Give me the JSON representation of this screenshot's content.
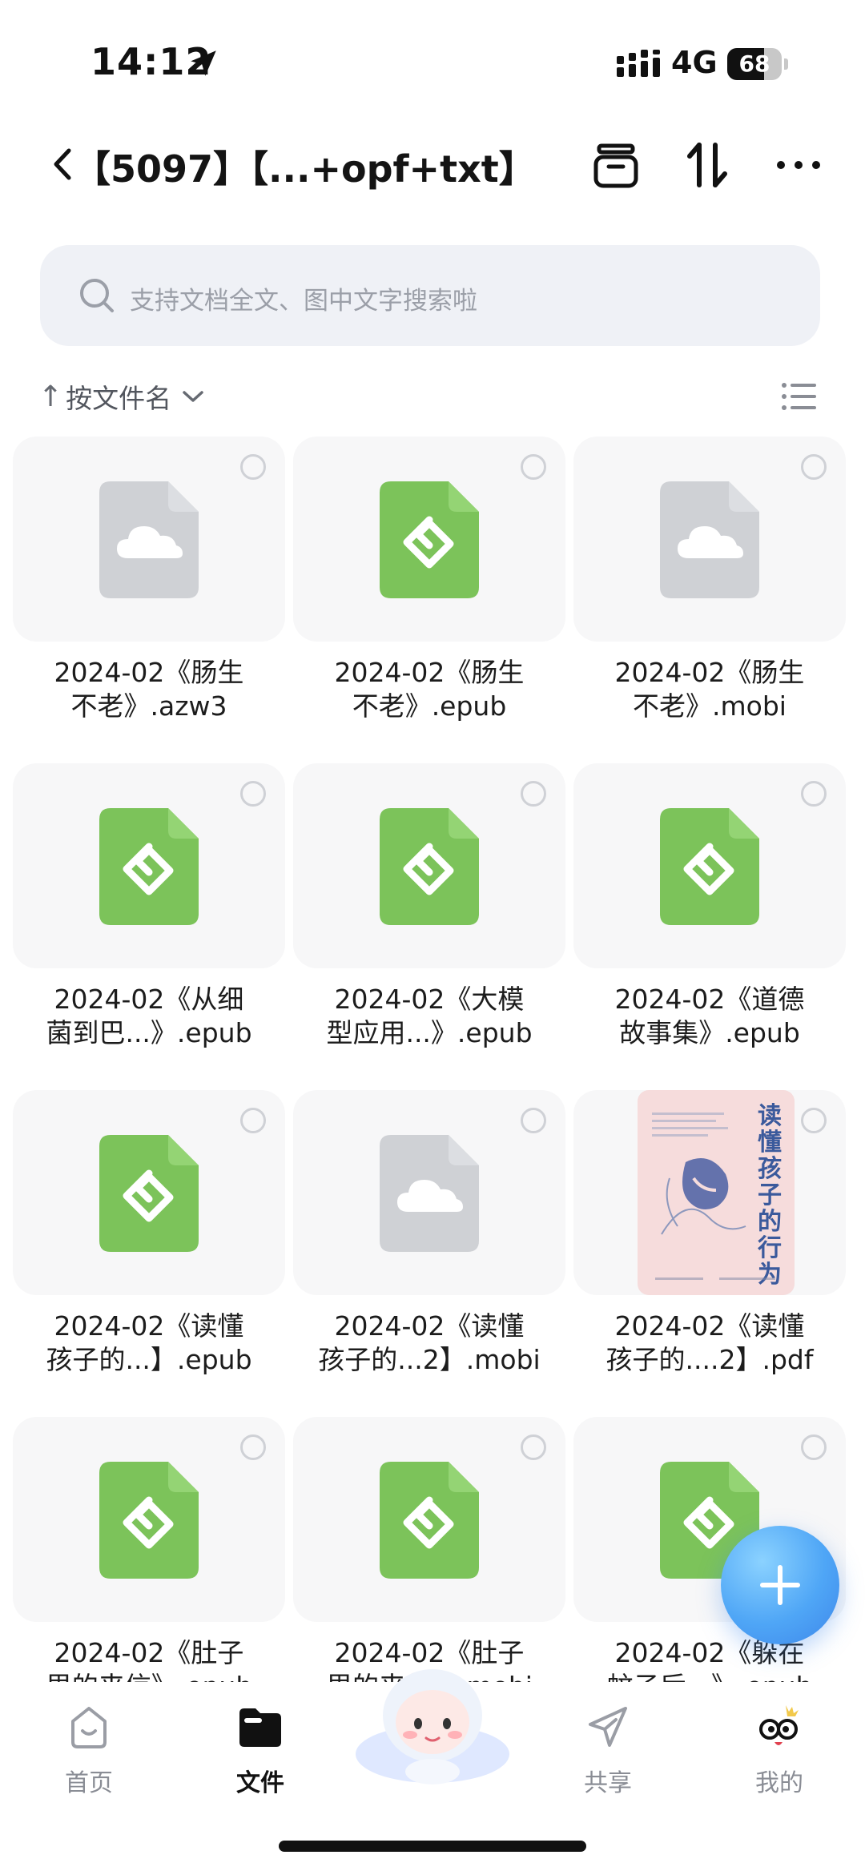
{
  "status_bar": {
    "time": "14:12",
    "network": "4G",
    "battery": "68",
    "battery_level_percent": 68
  },
  "header": {
    "title": "【5097】【...+opf+txt】",
    "icons": [
      "back-icon",
      "archive-icon",
      "sort-icon",
      "more-icon"
    ]
  },
  "search": {
    "placeholder": "支持文档全文、图中文字搜索啦"
  },
  "sort": {
    "arrow": "↑",
    "label": "按文件名"
  },
  "files": [
    {
      "line1": "2024-02《肠生",
      "line2": "不老》.azw3",
      "type": "cloud"
    },
    {
      "line1": "2024-02《肠生",
      "line2": "不老》.epub",
      "type": "epub"
    },
    {
      "line1": "2024-02《肠生",
      "line2": "不老》.mobi",
      "type": "cloud"
    },
    {
      "line1": "2024-02《从细",
      "line2": "菌到巴...》.epub",
      "type": "epub"
    },
    {
      "line1": "2024-02《大模",
      "line2": "型应用...》.epub",
      "type": "epub"
    },
    {
      "line1": "2024-02《道德",
      "line2": "故事集》.epub",
      "type": "epub"
    },
    {
      "line1": "2024-02《读懂",
      "line2": "孩子的...】.epub",
      "type": "epub"
    },
    {
      "line1": "2024-02《读懂",
      "line2": "孩子的...2】.mobi",
      "type": "cloud"
    },
    {
      "line1": "2024-02《读懂",
      "line2": "孩子的....2】.pdf",
      "type": "cover"
    },
    {
      "line1": "2024-02《肚子",
      "line2": "里的来信》.epub",
      "type": "epub"
    },
    {
      "line1": "2024-02《肚子",
      "line2": "里的来信》.mobi",
      "type": "epub"
    },
    {
      "line1": "2024-02《躲在",
      "line2": "蚊子后...》.epub",
      "type": "epub"
    }
  ],
  "book_cover": {
    "title": "读懂孩子的行为"
  },
  "fab": {
    "icon": "plus-icon"
  },
  "tabs": [
    {
      "label": "首页",
      "icon": "home-icon",
      "active": false
    },
    {
      "label": "文件",
      "icon": "folder-icon",
      "active": true
    },
    {
      "label": "共享",
      "icon": "share-icon",
      "active": false
    },
    {
      "label": "我的",
      "icon": "profile-icon",
      "active": false
    }
  ],
  "colors": {
    "epub_green": "#7cc35a",
    "cloud_gray": "#cfd1d5",
    "accent_blue": "#4fa6f6",
    "search_bg": "#eff1f6"
  }
}
